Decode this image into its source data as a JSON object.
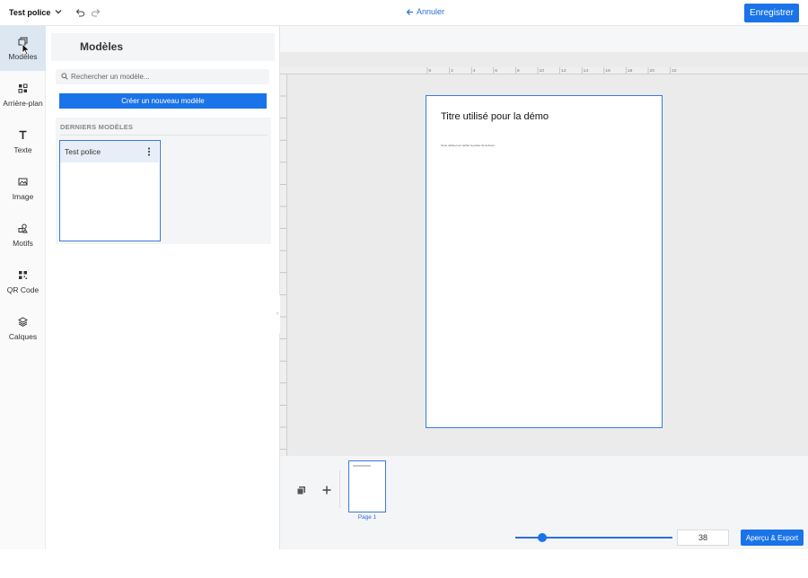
{
  "topbar": {
    "document_title": "Test police",
    "cancel_label": "Annuler",
    "save_label": "Enregistrer"
  },
  "rail": {
    "items": [
      {
        "label": "Modèles",
        "icon": "templates-icon",
        "active": true
      },
      {
        "label": "Arrière-plan",
        "icon": "background-icon"
      },
      {
        "label": "Texte",
        "icon": "text-icon"
      },
      {
        "label": "Image",
        "icon": "image-icon"
      },
      {
        "label": "Motifs",
        "icon": "shapes-icon"
      },
      {
        "label": "QR Code",
        "icon": "qr-code-icon"
      },
      {
        "label": "Calques",
        "icon": "layers-icon"
      }
    ]
  },
  "panel": {
    "title": "Modèles",
    "search_placeholder": "Rechercher un modèle...",
    "create_label": "Créer un nouveau modèle",
    "recent_heading": "DERNIERS MODÈLES",
    "recent_templates": [
      {
        "name": "Test police"
      }
    ]
  },
  "canvas": {
    "ruler_ticks": [
      "0",
      "2",
      "4",
      "6",
      "8",
      "10",
      "12",
      "14",
      "16",
      "18",
      "20",
      "22"
    ],
    "page_title": "Titre utilisé pour la démo",
    "page_subtext": "Texte utilisé pour vérifier la police de la démo"
  },
  "pages": {
    "items": [
      {
        "label": "Page 1"
      }
    ]
  },
  "zoom": {
    "value": "38",
    "level_fraction": 0.17
  },
  "export_label": "Aperçu & Export",
  "colors": {
    "accent": "#1a73e8",
    "selection": "#3b7ad9",
    "active_rail": "#dde7f2"
  }
}
